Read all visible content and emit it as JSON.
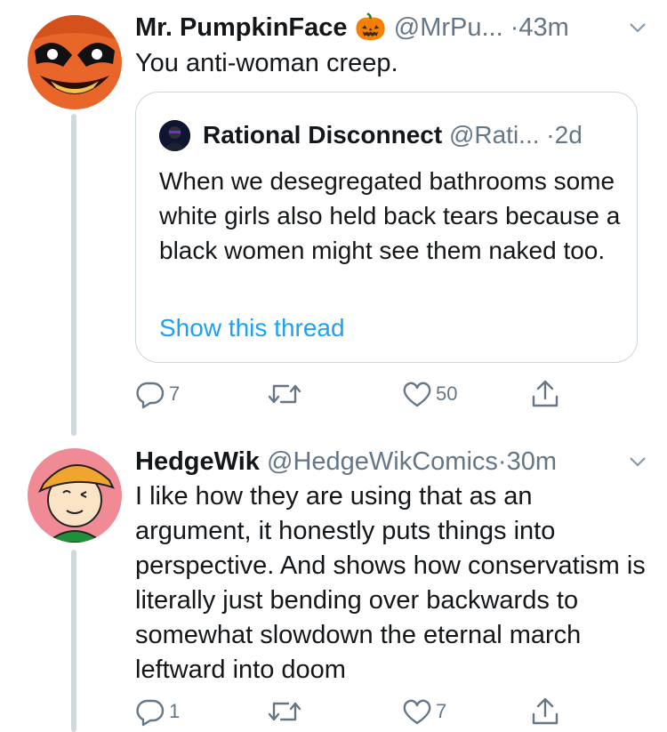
{
  "tweets": [
    {
      "name": "Mr. PumpkinFace",
      "emoji": "🎃",
      "handle": "@MrPu...",
      "dot": "·",
      "time": "43m",
      "text": "You anti-woman creep.",
      "quote": {
        "name": "Rational Disconnect",
        "handle": "@Rati...",
        "dot": "·",
        "time": "2d",
        "text": "When we desegregated bathrooms some white girls also held back tears because a black women might see them naked too.",
        "link": "Show this thread"
      },
      "actions": {
        "replies": "7",
        "retweets": "",
        "likes": "50"
      }
    },
    {
      "name": "HedgeWik",
      "handle": "@HedgeWikComics",
      "dot": "·",
      "time": "30m",
      "text": "I like how they are using that as an argument, it honestly puts things into perspective. And shows how conservatism is literally just bending over backwards to somewhat slowdown the eternal march leftward into doom",
      "actions": {
        "replies": "1",
        "retweets": "",
        "likes": "7"
      }
    }
  ],
  "icons": [
    "reply-icon",
    "retweet-icon",
    "like-icon",
    "share-icon",
    "chevron-down-icon"
  ],
  "colors": {
    "text": "#14171a",
    "muted": "#657786",
    "link": "#1da1f2",
    "border": "#ccd6dd",
    "line": "#cfd9de"
  }
}
